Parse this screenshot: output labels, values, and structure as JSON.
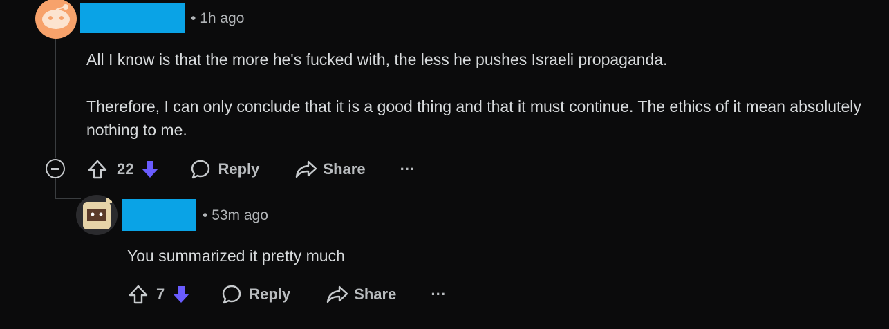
{
  "comment": {
    "timestamp": "1h ago",
    "paragraphs": [
      "All I know is that the more he's fucked with, the less he pushes Israeli propaganda.",
      "Therefore, I can only conclude that it is a good thing and that it must continue. The ethics of it mean absolutely nothing to me."
    ],
    "votes": "22",
    "reply_label": "Reply",
    "share_label": "Share",
    "more_label": "···"
  },
  "reply": {
    "timestamp": "53m ago",
    "text": "You summarized it pretty much",
    "votes": "7",
    "reply_label": "Reply",
    "share_label": "Share",
    "more_label": "···"
  },
  "colors": {
    "background": "#0b0b0c",
    "username_redaction": "#0aa3e6",
    "downvote_active": "#6a5cff",
    "avatar_orange": "#f7a26b"
  },
  "icons": [
    "snoo-avatar-icon",
    "custom-avatar-icon",
    "collapse-icon",
    "upvote-icon",
    "downvote-icon",
    "comment-icon",
    "share-icon",
    "more-icon"
  ]
}
